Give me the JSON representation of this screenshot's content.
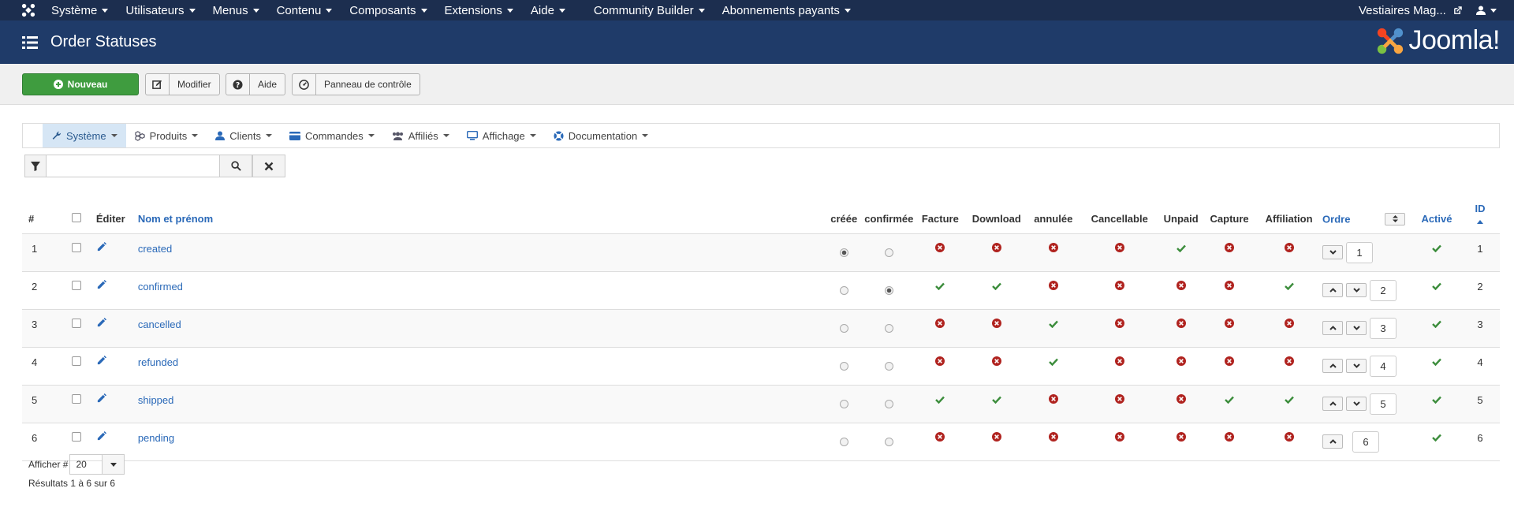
{
  "topnav": {
    "items": [
      "Système",
      "Utilisateurs",
      "Menus",
      "Contenu",
      "Composants",
      "Extensions",
      "Aide",
      "Community Builder",
      "Abonnements payants"
    ],
    "site_name": "Vestiaires Mag..."
  },
  "header": {
    "title": "Order Statuses",
    "brand": "Joomla!"
  },
  "toolbar": {
    "new_label": "Nouveau",
    "edit_label": "Modifier",
    "help_label": "Aide",
    "cpanel_label": "Panneau de contrôle"
  },
  "subnav": {
    "items": [
      "Système",
      "Produits",
      "Clients",
      "Commandes",
      "Affiliés",
      "Affichage",
      "Documentation"
    ]
  },
  "filter": {
    "search_value": ""
  },
  "table": {
    "headers": {
      "num": "#",
      "edit": "Éditer",
      "name": "Nom et prénom",
      "created": "créée",
      "confirmed": "confirmée",
      "invoice": "Facture",
      "download": "Download",
      "cancelled": "annulée",
      "cancellable": "Cancellable",
      "unpaid": "Unpaid",
      "capture": "Capture",
      "affiliation": "Affiliation",
      "order": "Ordre",
      "active": "Activé",
      "id": "ID"
    },
    "rows": [
      {
        "num": "1",
        "name": "created",
        "created": true,
        "confirmed": false,
        "invoice": false,
        "download": false,
        "cancelled": false,
        "cancellable": false,
        "unpaid": true,
        "capture": false,
        "affiliation": false,
        "order": "1",
        "up": false,
        "down": true,
        "active": true,
        "id": "1"
      },
      {
        "num": "2",
        "name": "confirmed",
        "created": false,
        "confirmed": true,
        "invoice": true,
        "download": true,
        "cancelled": false,
        "cancellable": false,
        "unpaid": false,
        "capture": false,
        "affiliation": true,
        "order": "2",
        "up": true,
        "down": true,
        "active": true,
        "id": "2"
      },
      {
        "num": "3",
        "name": "cancelled",
        "created": false,
        "confirmed": false,
        "invoice": false,
        "download": false,
        "cancelled": true,
        "cancellable": false,
        "unpaid": false,
        "capture": false,
        "affiliation": false,
        "order": "3",
        "up": true,
        "down": true,
        "active": true,
        "id": "3"
      },
      {
        "num": "4",
        "name": "refunded",
        "created": false,
        "confirmed": false,
        "invoice": false,
        "download": false,
        "cancelled": true,
        "cancellable": false,
        "unpaid": false,
        "capture": false,
        "affiliation": false,
        "order": "4",
        "up": true,
        "down": true,
        "active": true,
        "id": "4"
      },
      {
        "num": "5",
        "name": "shipped",
        "created": false,
        "confirmed": false,
        "invoice": true,
        "download": true,
        "cancelled": false,
        "cancellable": false,
        "unpaid": false,
        "capture": true,
        "affiliation": true,
        "order": "5",
        "up": true,
        "down": true,
        "active": true,
        "id": "5"
      },
      {
        "num": "6",
        "name": "pending",
        "created": false,
        "confirmed": false,
        "invoice": false,
        "download": false,
        "cancelled": false,
        "cancellable": false,
        "unpaid": false,
        "capture": false,
        "affiliation": false,
        "order": "6",
        "up": true,
        "down": false,
        "active": true,
        "id": "6"
      }
    ]
  },
  "footer": {
    "limit_label": "Afficher #",
    "limit_value": "20",
    "results": "Résultats 1 à 6 sur 6"
  },
  "colors": {
    "topnav": "#1c2e4f",
    "header": "#1f3b69",
    "new_button": "#3f9c3f",
    "check": "#3c8d3c",
    "cross": "#b0231f",
    "link": "#2a69b8"
  }
}
